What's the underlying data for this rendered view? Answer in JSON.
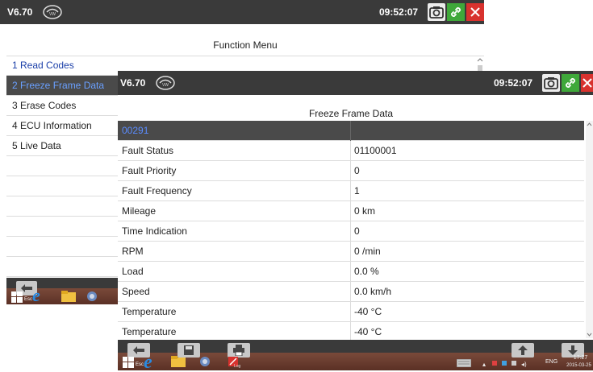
{
  "back_window": {
    "version": "V6.70",
    "time": "09:52:07",
    "header": "Function Menu",
    "menu_items": [
      {
        "label": "1  Read Codes"
      },
      {
        "label": "2  Freeze Frame Data"
      },
      {
        "label": "3  Erase Codes"
      },
      {
        "label": "4  ECU Information"
      },
      {
        "label": "5  Live Data"
      }
    ]
  },
  "front_window": {
    "version": "V6.70",
    "time": "09:52:07",
    "header": "Freeze Frame Data",
    "code": "00291",
    "rows": [
      {
        "label": "Fault Status",
        "value": "01100001"
      },
      {
        "label": "Fault Priority",
        "value": "0"
      },
      {
        "label": "Fault Frequency",
        "value": "1"
      },
      {
        "label": "Mileage",
        "value": "0 km"
      },
      {
        "label": "Time Indication",
        "value": "0"
      },
      {
        "label": "RPM",
        "value": "0 /min"
      },
      {
        "label": "Load",
        "value": "0.0 %"
      },
      {
        "label": "Speed",
        "value": "0.0 km/h"
      },
      {
        "label": "Temperature",
        "value": "-40 °C"
      },
      {
        "label": "Temperature",
        "value": "-40 °C"
      }
    ]
  },
  "taskbar": {
    "lang": "ENG",
    "clock_time": "17:27",
    "clock_date": "2015-03-25",
    "esc": "Esc",
    "partial_label": "Log"
  },
  "icons": [
    "camera-icon",
    "link-icon",
    "close-icon",
    "back-arrow-icon",
    "save-icon",
    "print-icon",
    "up-arrow-icon",
    "down-arrow-icon"
  ],
  "colors": {
    "titlebar": "#3a3a3a",
    "selected": "#4a4a4a",
    "accent_blue": "#1a3ea8",
    "link_green": "#3fa83a",
    "close_red": "#d8322e"
  }
}
